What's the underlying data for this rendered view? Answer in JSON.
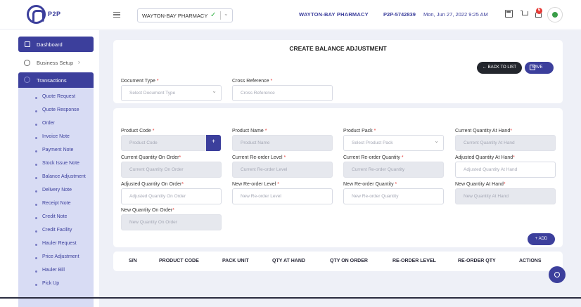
{
  "header": {
    "logo_text": "P2P",
    "pharmacy_select": "WAYTON-BAY PHARMACY",
    "pharmacy_name": "WAYTON-BAY PHARMACY",
    "code": "P2P-5742839",
    "datetime": "Mon, Jun 27, 2022 9:25 AM",
    "notification_count": "5"
  },
  "sidebar": {
    "dashboard": "Dashboard",
    "business_setup": "Business Setup",
    "transactions": "Transactions",
    "sub_items": [
      "Quote Request",
      "Quote Response",
      "Order",
      "Invoice Note",
      "Payment Note",
      "Stock Issue Note",
      "Balance Adjustment",
      "Delivery Note",
      "Receipt Note",
      "Credit Note",
      "Credit Facility",
      "Hauler Request",
      "Price Adjustment",
      "Hauler Bill",
      "Pick Up"
    ]
  },
  "form": {
    "title": "CREATE BALANCE ADJUSTMENT",
    "back_label": "BACK TO LIST",
    "save_label": "SAVE",
    "add_label": "+ ADD",
    "document_type": {
      "label": "Document Type",
      "placeholder": "Select Document Type"
    },
    "cross_reference": {
      "label": "Cross Reference",
      "placeholder": "Cross Reference"
    },
    "product_code": {
      "label": "Product Code",
      "placeholder": "Product Code"
    },
    "product_name": {
      "label": "Product Name",
      "placeholder": "Product Name"
    },
    "product_pack": {
      "label": "Product Pack",
      "placeholder": "Select Product Pack"
    },
    "current_qty_hand": {
      "label": "Current Quantity At Hand",
      "placeholder": "Current Quantity At Hand"
    },
    "current_qty_order": {
      "label": "Current Quantity On Order",
      "placeholder": "Current Quantity On Order"
    },
    "current_reorder_level": {
      "label": "Current Re-order Level",
      "placeholder": "Current Re-order Level"
    },
    "current_reorder_qty": {
      "label": "Current Re-order Quantity",
      "placeholder": "Current Re-order Quantity"
    },
    "adjusted_qty_hand": {
      "label": "Adjusted Quantity At Hand",
      "placeholder": "Adjusted Quantity At Hand"
    },
    "adjusted_qty_order": {
      "label": "Adjusted Quantity On Order",
      "placeholder": "Adjusted Quantity On Order"
    },
    "new_reorder_level": {
      "label": "New Re-order Level",
      "placeholder": "New Re-order Level"
    },
    "new_reorder_qty": {
      "label": "New Re-order Quantity",
      "placeholder": "New Re-order Quantity"
    },
    "new_qty_hand": {
      "label": "New Quantity At Hand",
      "placeholder": "New Quantity At Hand"
    },
    "new_qty_order": {
      "label": "New Quantity On Order",
      "placeholder": "New Quantity On Order"
    }
  },
  "table": {
    "headers": [
      "S/N",
      "PRODUCT CODE",
      "PACK UNIT",
      "QTY AT HAND",
      "QTY ON ORDER",
      "RE-ORDER LEVEL",
      "RE-ORDER QTY",
      "ACTIONS"
    ]
  },
  "colors": {
    "primary": "#3c3f9c",
    "dark_button": "#23262d",
    "success": "#38b34a",
    "badge": "#e53935"
  }
}
